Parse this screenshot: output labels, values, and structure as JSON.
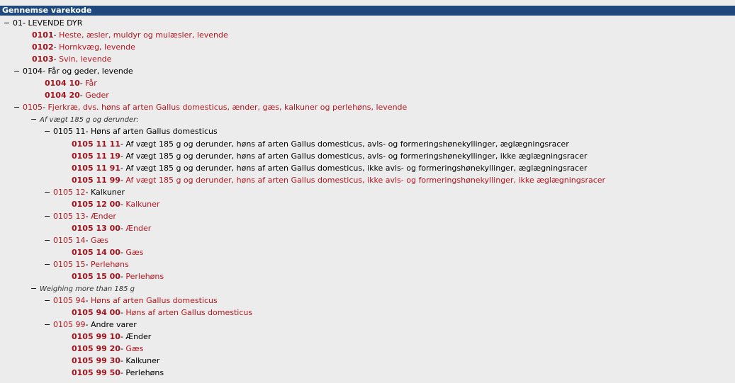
{
  "header": {
    "title": "Gennemse varekode"
  },
  "rows": [
    {
      "indent": 0,
      "toggle": "−",
      "code": "01",
      "desc": "LEVENDE DYR",
      "codeColor": "black",
      "descColor": "black",
      "leaf": false
    },
    {
      "indent": 1,
      "toggle": "",
      "code": "0101",
      "desc": "Heste, æsler, muldyr og mulæsler, levende",
      "leaf": true,
      "descColor": "red"
    },
    {
      "indent": 1,
      "toggle": "",
      "code": "0102",
      "desc": "Hornkvæg, levende",
      "leaf": true,
      "descColor": "red"
    },
    {
      "indent": 1,
      "toggle": "",
      "code": "0103",
      "desc": "Svin, levende",
      "leaf": true,
      "descColor": "red"
    },
    {
      "indent": 1,
      "toggle": "−",
      "code": "0104",
      "desc": "Får og geder, levende",
      "codeColor": "black",
      "descColor": "black",
      "leaf": false
    },
    {
      "indent": 2,
      "toggle": "",
      "code": "0104 10",
      "desc": "Får",
      "leaf": true,
      "descColor": "red"
    },
    {
      "indent": 2,
      "toggle": "",
      "code": "0104 20",
      "desc": "Geder",
      "leaf": true,
      "descColor": "red"
    },
    {
      "indent": 1,
      "toggle": "−",
      "code": "0105",
      "desc": "Fjerkræ, dvs. høns af arten Gallus domesticus, ænder, gæs, kalkuner og perlehøns, levende",
      "codeColor": "red",
      "descColor": "red",
      "leaf": false
    },
    {
      "indent": 2,
      "toggle": "−",
      "code": "",
      "desc": "Af vægt 185 g og derunder:",
      "italic": true,
      "leaf": false
    },
    {
      "indent": 3,
      "toggle": "−",
      "code": "0105 11",
      "desc": "Høns af arten Gallus domesticus",
      "codeColor": "black",
      "descColor": "black",
      "leaf": false
    },
    {
      "indent": 5,
      "toggle": "",
      "code": "0105 11 11",
      "desc": "Af vægt 185 g og derunder, høns af arten Gallus domesticus, avls- og formeringshønekyllinger, æglægningsracer",
      "leaf": true,
      "descColor": "black"
    },
    {
      "indent": 5,
      "toggle": "",
      "code": "0105 11 19",
      "desc": "Af vægt 185 g og derunder, høns af arten Gallus domesticus, avls- og formeringshønekyllinger, ikke æglægningsracer",
      "leaf": true,
      "descColor": "black"
    },
    {
      "indent": 5,
      "toggle": "",
      "code": "0105 11 91",
      "desc": "Af vægt 185 g og derunder, høns af arten Gallus domesticus, ikke avls- og formeringshønekyllinger, æglægningsracer",
      "leaf": true,
      "descColor": "black"
    },
    {
      "indent": 5,
      "toggle": "",
      "code": "0105 11 99",
      "desc": "Af vægt 185 g og derunder, høns af arten Gallus domesticus, ikke avls- og formeringshønekyllinger, ikke æglægningsracer",
      "leaf": true,
      "descColor": "red"
    },
    {
      "indent": 3,
      "toggle": "−",
      "code": "0105 12",
      "desc": "Kalkuner",
      "codeColor": "red",
      "descColor": "black",
      "leaf": false
    },
    {
      "indent": 4,
      "toggle": "",
      "code": "0105 12 00",
      "desc": "Kalkuner",
      "leaf": true,
      "descColor": "red"
    },
    {
      "indent": 3,
      "toggle": "−",
      "code": "0105 13",
      "desc": "Ænder",
      "codeColor": "red",
      "descColor": "red",
      "leaf": false
    },
    {
      "indent": 4,
      "toggle": "",
      "code": "0105 13 00",
      "desc": "Ænder",
      "leaf": true,
      "descColor": "red"
    },
    {
      "indent": 3,
      "toggle": "−",
      "code": "0105 14",
      "desc": "Gæs",
      "codeColor": "red",
      "descColor": "red",
      "leaf": false
    },
    {
      "indent": 4,
      "toggle": "",
      "code": "0105 14 00",
      "desc": "Gæs",
      "leaf": true,
      "descColor": "red"
    },
    {
      "indent": 3,
      "toggle": "−",
      "code": "0105 15",
      "desc": "Perlehøns",
      "codeColor": "red",
      "descColor": "red",
      "leaf": false
    },
    {
      "indent": 4,
      "toggle": "",
      "code": "0105 15 00",
      "desc": "Perlehøns",
      "leaf": true,
      "descColor": "red"
    },
    {
      "indent": 2,
      "toggle": "−",
      "code": "",
      "desc": "Weighing more than 185 g",
      "italic": true,
      "leaf": false
    },
    {
      "indent": 3,
      "toggle": "−",
      "code": "0105 94",
      "desc": "Høns af arten Gallus domesticus",
      "codeColor": "red",
      "descColor": "red",
      "leaf": false
    },
    {
      "indent": 4,
      "toggle": "",
      "code": "0105 94 00",
      "desc": "Høns af arten Gallus domesticus",
      "leaf": true,
      "descColor": "red"
    },
    {
      "indent": 3,
      "toggle": "−",
      "code": "0105 99",
      "desc": "Andre varer",
      "codeColor": "red",
      "descColor": "black",
      "leaf": false
    },
    {
      "indent": 4,
      "toggle": "",
      "code": "0105 99 10",
      "desc": "Ænder",
      "leaf": true,
      "descColor": "black"
    },
    {
      "indent": 4,
      "toggle": "",
      "code": "0105 99 20",
      "desc": "Gæs",
      "leaf": true,
      "descColor": "red"
    },
    {
      "indent": 4,
      "toggle": "",
      "code": "0105 99 30",
      "desc": "Kalkuner",
      "leaf": true,
      "descColor": "black"
    },
    {
      "indent": 4,
      "toggle": "",
      "code": "0105 99 50",
      "desc": "Perlehøns",
      "leaf": true,
      "descColor": "black"
    }
  ]
}
